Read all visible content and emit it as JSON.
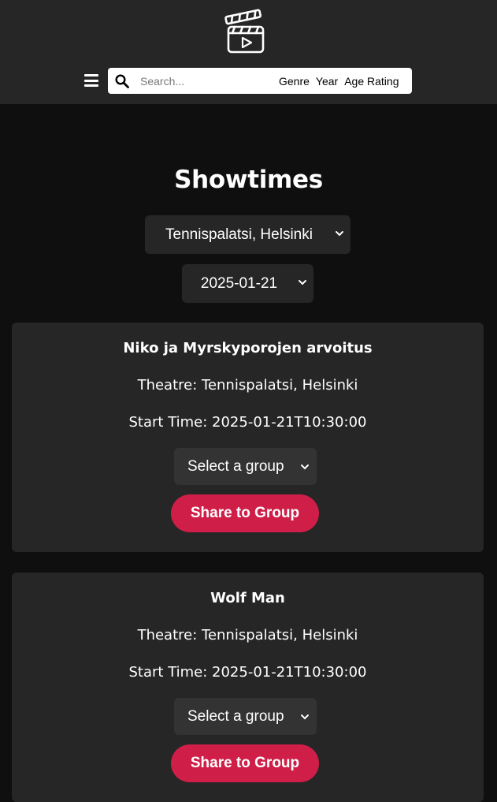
{
  "header": {
    "logo_icon": "clapperboard-play-icon",
    "menu_icon": "hamburger-menu-icon",
    "search": {
      "icon": "search-icon",
      "placeholder": "Search...",
      "value": ""
    },
    "filters": [
      "Genre",
      "Year",
      "Age Rating"
    ]
  },
  "main": {
    "title": "Showtimes",
    "theatre_select": {
      "selected": "Tennispalatsi, Helsinki"
    },
    "date_select": {
      "selected": "2025-01-21"
    }
  },
  "showtimes": [
    {
      "title": "Niko ja Myrskyporojen arvoitus",
      "theatre": "Theatre: Tennispalatsi, Helsinki",
      "start_time": "Start Time: 2025-01-21T10:30:00",
      "group_select": "Select a group",
      "share_label": "Share to Group"
    },
    {
      "title": "Wolf Man",
      "theatre": "Theatre: Tennispalatsi, Helsinki",
      "start_time": "Start Time: 2025-01-21T10:30:00",
      "group_select": "Select a group",
      "share_label": "Share to Group"
    }
  ],
  "colors": {
    "background": "#0f0f0f",
    "header": "#262626",
    "card": "#262626",
    "accent": "#cf1f48"
  }
}
